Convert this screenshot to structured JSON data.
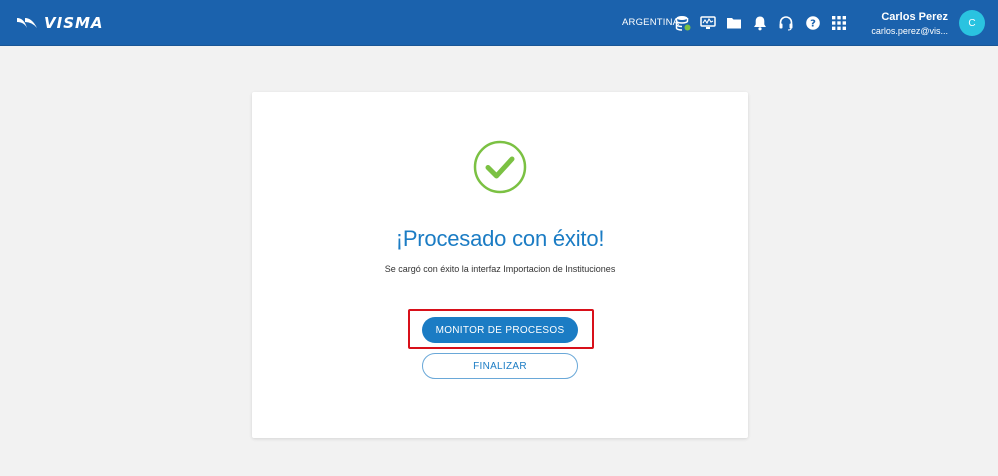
{
  "header": {
    "brand": "VISMA",
    "country": "ARGENTINA",
    "icons": [
      "database-icon",
      "monitor-icon",
      "folder-icon",
      "bell-icon",
      "headset-icon",
      "help-icon",
      "apps-grid-icon"
    ],
    "user": {
      "name": "Carlos Perez",
      "email": "carlos.perez@vis...",
      "initial": "C"
    },
    "colors": {
      "bar": "#1b62ad",
      "avatar": "#2ac3e0"
    }
  },
  "result": {
    "title": "¡Procesado con éxito!",
    "message": "Se cargó con éxito la interfaz Importacion de Instituciones",
    "primary_button": "MONITOR DE PROCESOS",
    "secondary_button": "FINALIZAR",
    "colors": {
      "success": "#7bc143",
      "accent": "#1b7cc4",
      "highlight": "#d8101a"
    }
  }
}
